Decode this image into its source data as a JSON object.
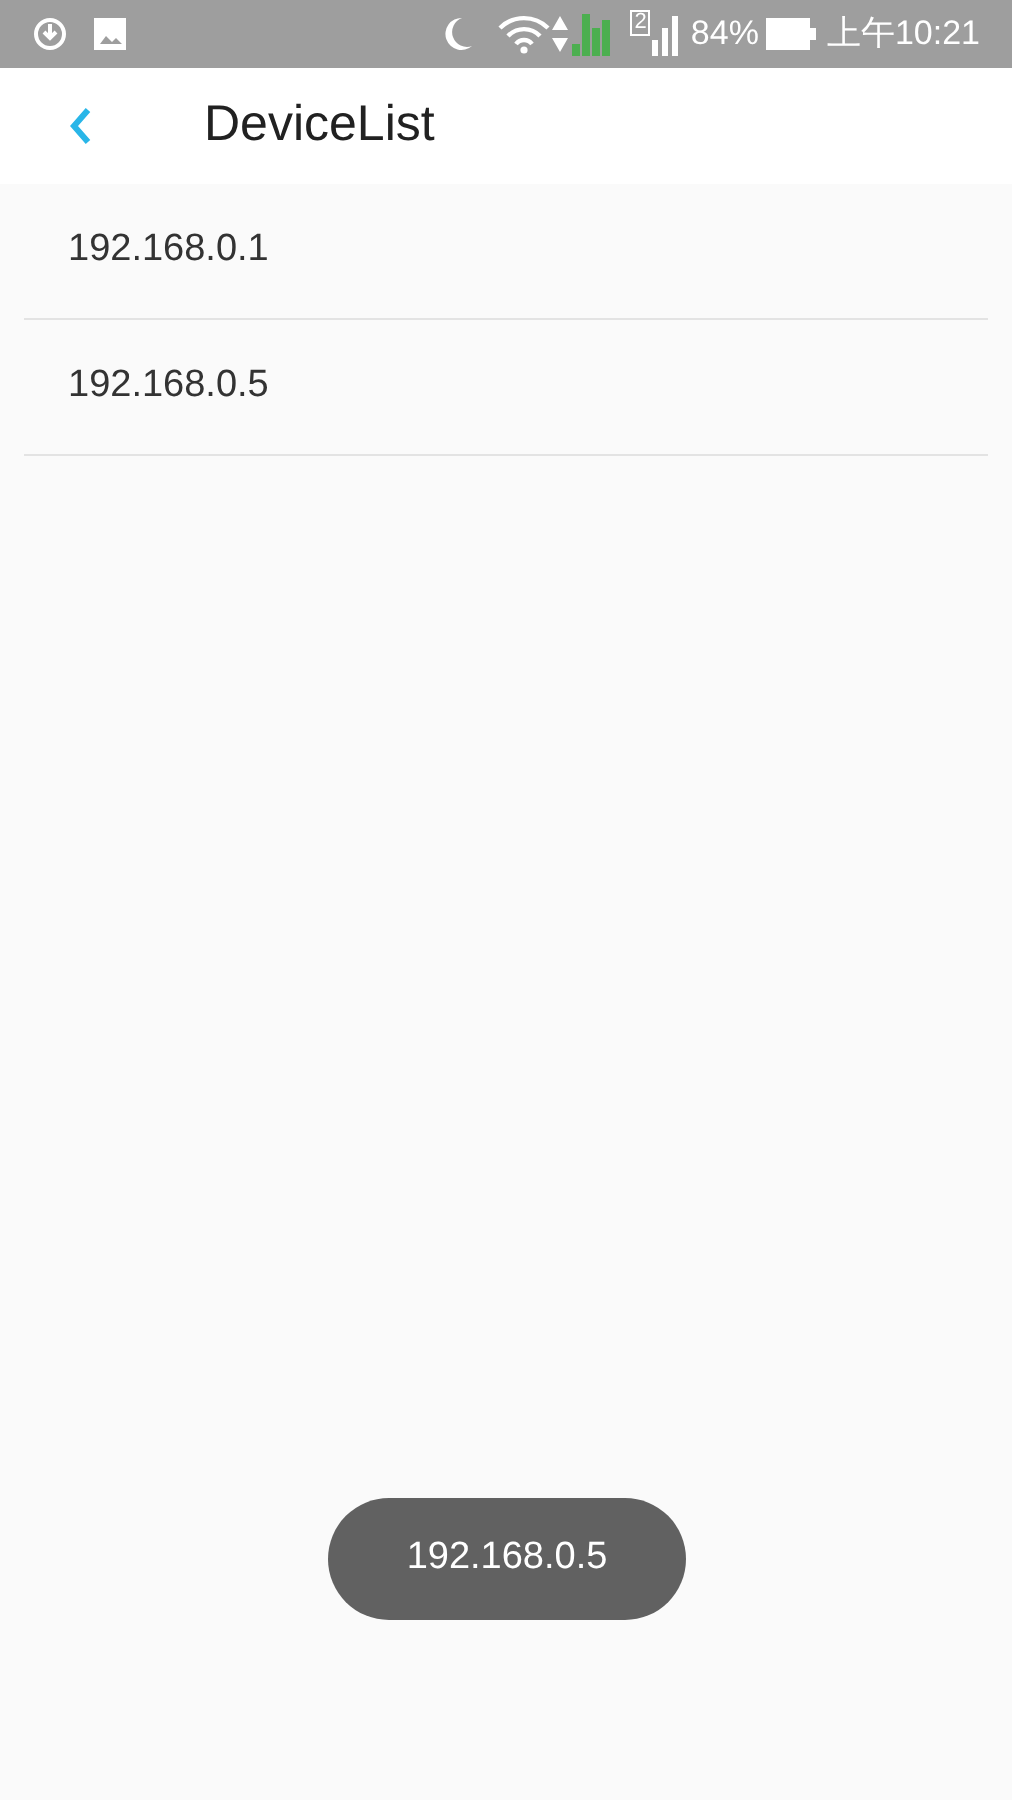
{
  "status_bar": {
    "sim_label": "2",
    "battery": "84%",
    "time": "上午10:21"
  },
  "header": {
    "title": "DeviceList"
  },
  "devices": [
    {
      "address": "192.168.0.1"
    },
    {
      "address": "192.168.0.5"
    }
  ],
  "toast": {
    "text": "192.168.0.5"
  }
}
